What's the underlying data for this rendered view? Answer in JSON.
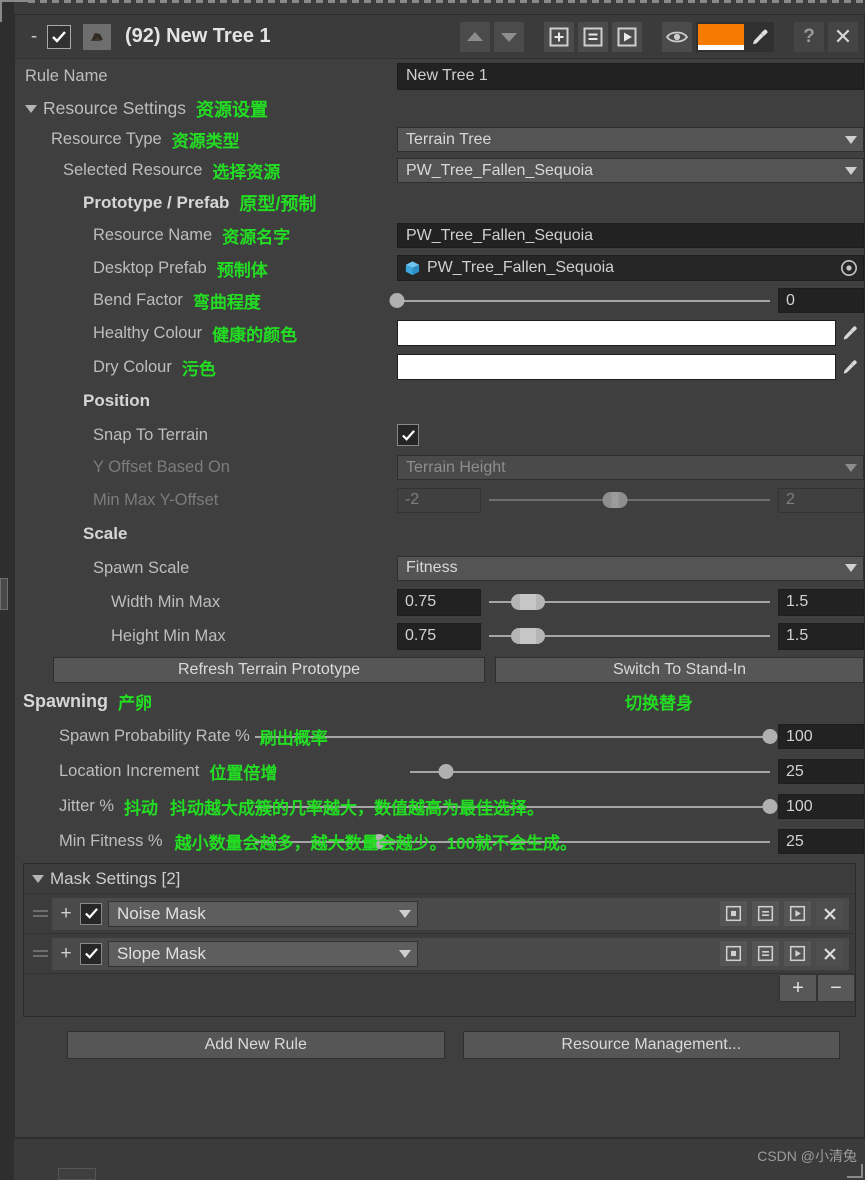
{
  "titlebar": {
    "collapse_label": "-",
    "enabled": true,
    "title": "(92) New Tree 1",
    "icon_name": "tree-thumbnail-icon",
    "buttons": [
      {
        "name": "move-up-button",
        "icon": "arrow-up-icon"
      },
      {
        "name": "move-down-button",
        "icon": "arrow-down-icon"
      },
      {
        "name": "add-button",
        "icon": "plus-box-icon"
      },
      {
        "name": "list-button",
        "icon": "list-box-icon"
      },
      {
        "name": "play-button",
        "icon": "play-box-icon"
      },
      {
        "name": "visibility-button",
        "icon": "eye-icon"
      }
    ],
    "color_swatch": "#F57C00",
    "color_swatch_alpha_bar": "#FFFFFF",
    "eyedropper_icon": "eyedropper-icon",
    "help_label": "?",
    "close_label": "✕"
  },
  "rule": {
    "name_label": "Rule Name",
    "name_value": "New Tree 1"
  },
  "resource_settings": {
    "header": "Resource Settings",
    "header_zh": "资源设置",
    "resource_type_label": "Resource Type",
    "resource_type_zh": "资源类型",
    "resource_type_value": "Terrain Tree",
    "selected_resource_label": "Selected Resource",
    "selected_resource_zh": "选择资源",
    "selected_resource_value": "PW_Tree_Fallen_Sequoia"
  },
  "prototype": {
    "header": "Prototype / Prefab",
    "header_zh": "原型/预制",
    "resource_name_label": "Resource Name",
    "resource_name_zh": "资源名字",
    "resource_name_value": "PW_Tree_Fallen_Sequoia",
    "desktop_prefab_label": "Desktop Prefab",
    "desktop_prefab_zh": "预制体",
    "desktop_prefab_value": "PW_Tree_Fallen_Sequoia",
    "desktop_prefab_icon": "prefab-cube-icon",
    "bend_factor_label": "Bend Factor",
    "bend_factor_zh": "弯曲程度",
    "bend_factor_value": "0",
    "bend_factor_percent": 0,
    "healthy_colour_label": "Healthy Colour",
    "healthy_colour_zh": "健康的颜色",
    "healthy_colour_value": "#FFFFFF",
    "dry_colour_label": "Dry Colour",
    "dry_colour_zh": "污色",
    "dry_colour_value": "#FFFFFF"
  },
  "position": {
    "header": "Position",
    "snap_label": "Snap To Terrain",
    "snap_checked": true,
    "y_offset_label": "Y Offset Based On",
    "y_offset_value": "Terrain Height",
    "minmax_label": "Min Max Y-Offset",
    "minmax_min": "-2",
    "minmax_max": "2",
    "minmax_handle_percent": 45
  },
  "scale": {
    "header": "Scale",
    "spawn_scale_label": "Spawn Scale",
    "spawn_scale_value": "Fitness",
    "width_label": "Width Min Max",
    "width_min": "0.75",
    "width_max": "1.5",
    "width_handle_percent": 14,
    "height_label": "Height Min Max",
    "height_min": "0.75",
    "height_max": "1.5",
    "height_handle_percent": 14
  },
  "actions": {
    "refresh_label": "Refresh Terrain Prototype",
    "switch_label": "Switch To Stand-In",
    "switch_zh": "切换替身"
  },
  "spawning": {
    "header": "Spawning",
    "header_zh": "产卵",
    "rows": [
      {
        "label": "Spawn Probability Rate %",
        "zh": "刷出概率",
        "value": "100",
        "percent": 100
      },
      {
        "label": "Location Increment",
        "zh": "位置倍增",
        "value": "25",
        "percent": 10
      },
      {
        "label": "Jitter %",
        "zh": "抖动",
        "zh_note": "抖动越大成簇的几率越大，数值越高为最佳选择。",
        "value": "100",
        "percent": 100
      },
      {
        "label": "Min Fitness %",
        "zh": "",
        "zh_note": "越小数量会越多，越大数量会越少。100就不会生成。",
        "value": "25",
        "percent": 24
      }
    ]
  },
  "mask_settings": {
    "header": "Mask Settings [2]",
    "rows": [
      {
        "label": "Noise Mask",
        "checked": true
      },
      {
        "label": "Slope Mask",
        "checked": true
      }
    ],
    "row_buttons": [
      {
        "name": "mask-add-button",
        "icon": "add-box-icon"
      },
      {
        "name": "mask-duplicate-button",
        "icon": "list-box-icon"
      },
      {
        "name": "mask-play-button",
        "icon": "play-box-icon"
      },
      {
        "name": "mask-remove-button",
        "icon": "close-icon"
      }
    ],
    "add_label": "+",
    "remove_label": "−"
  },
  "footer": {
    "add_rule_label": "Add New Rule",
    "resource_management_label": "Resource Management..."
  },
  "watermark": "CSDN @小清兔"
}
